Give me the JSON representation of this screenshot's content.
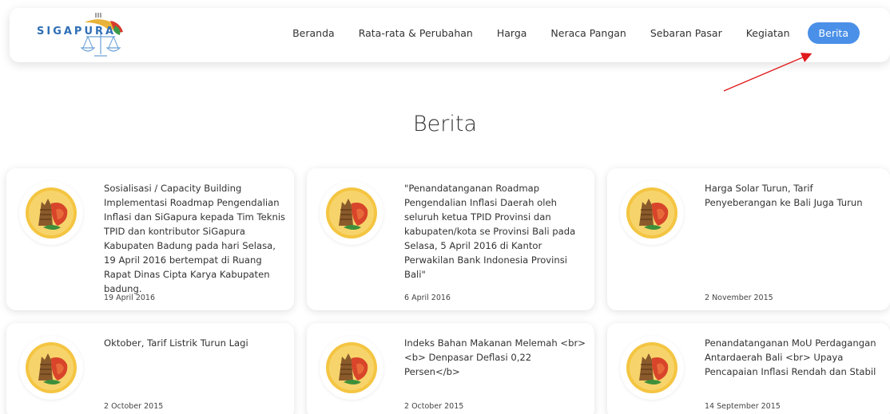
{
  "brand": {
    "logo_text": "SIGAPURA"
  },
  "nav": {
    "items": [
      "Beranda",
      "Rata-rata & Perubahan",
      "Harga",
      "Neraca Pangan",
      "Sebaran Pasar",
      "Kegiatan"
    ],
    "active": "Berita"
  },
  "page": {
    "title": "Berita"
  },
  "colors": {
    "accent": "#4a90e8",
    "annotation_arrow": "#e0191b"
  },
  "news": [
    {
      "title": "Sosialisasi / Capacity Building Implementasi Roadmap Pengendalian Inflasi dan SiGapura kepada Tim Teknis TPID dan kontributor SiGapura Kabupaten Badung pada hari Selasa, 19 April 2016 bertempat di Ruang Rapat Dinas Cipta Karya Kabupaten badung.",
      "date": "19 April 2016"
    },
    {
      "title": "\"Penandatanganan Roadmap Pengendalian Inflasi Daerah oleh seluruh ketua TPID Provinsi dan kabupaten/kota se Provinsi Bali pada Selasa, 5 April 2016 di Kantor Perwakilan Bank Indonesia Provinsi Bali\"",
      "date": "6 April 2016"
    },
    {
      "title": "Harga Solar Turun, Tarif Penyeberangan ke Bali Juga Turun",
      "date": "2 November 2015"
    },
    {
      "title": "Oktober, Tarif Listrik Turun Lagi",
      "date": "2 October 2015"
    },
    {
      "title": "Indeks Bahan Makanan Melemah <br> <b> Denpasar Deflasi 0,22 Persen</b>",
      "date": "2 October 2015"
    },
    {
      "title": "Penandatanganan MoU Perdagangan Antardaerah Bali <br> Upaya Pencapaian Inflasi Rendah dan Stabil",
      "date": "14 September 2015"
    }
  ]
}
